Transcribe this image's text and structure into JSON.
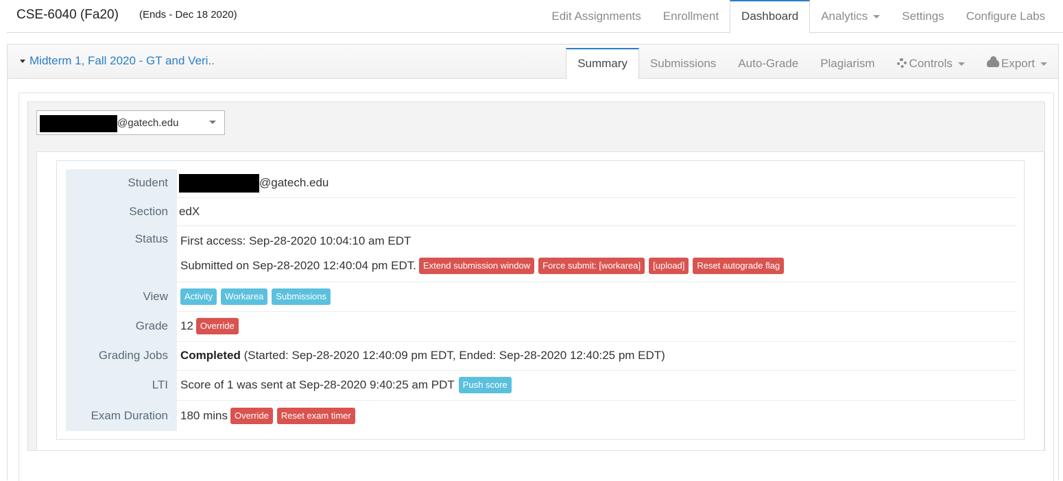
{
  "header": {
    "course_title": "CSE-6040 (Fa20)",
    "course_ends": "(Ends - Dec 18 2020)",
    "tabs": [
      {
        "label": "Edit Assignments"
      },
      {
        "label": "Enrollment"
      },
      {
        "label": "Dashboard",
        "active": true
      },
      {
        "label": "Analytics",
        "dropdown": true
      },
      {
        "label": "Settings"
      },
      {
        "label": "Configure Labs"
      }
    ]
  },
  "assignment": {
    "title": "Midterm 1, Fall 2020 - GT and Veri..",
    "tabs": [
      {
        "label": "Summary",
        "active": true
      },
      {
        "label": "Submissions"
      },
      {
        "label": "Auto-Grade"
      },
      {
        "label": "Plagiarism"
      },
      {
        "label": "Controls",
        "icon": "gear-icon",
        "dropdown": true
      },
      {
        "label": "Export",
        "icon": "cloud-download-icon",
        "dropdown": true
      }
    ]
  },
  "student_select": {
    "value_domain": "@gatech.edu",
    "redacted": true
  },
  "summary": {
    "student": {
      "label": "Student",
      "domain": "@gatech.edu",
      "redacted": true
    },
    "section": {
      "label": "Section",
      "value": "edX"
    },
    "status": {
      "label": "Status",
      "first_access": "First access: Sep-28-2020 10:04:10 am EDT",
      "submitted": "Submitted on Sep-28-2020 12:40:04 pm EDT.",
      "buttons": [
        "Extend submission window",
        "Force submit: [workarea]",
        "[upload]",
        "Reset autograde flag"
      ]
    },
    "view": {
      "label": "View",
      "buttons": [
        "Activity",
        "Workarea",
        "Submissions"
      ]
    },
    "grade": {
      "label": "Grade",
      "value": "12",
      "button": "Override"
    },
    "grading_jobs": {
      "label": "Grading Jobs",
      "state": "Completed",
      "detail": "(Started: Sep-28-2020 12:40:09 pm EDT, Ended: Sep-28-2020 12:40:25 pm EDT)"
    },
    "lti": {
      "label": "LTI",
      "value": "Score of 1 was sent at Sep-28-2020 9:40:25 am PDT",
      "button": "Push score"
    },
    "exam_duration": {
      "label": "Exam Duration",
      "value": "180 mins",
      "buttons": [
        "Override",
        "Reset exam timer"
      ]
    }
  },
  "colors": {
    "accent": "#2a7ec8",
    "danger": "#d9534f",
    "info": "#5bc0de",
    "label_bg": "#e8eff5"
  }
}
